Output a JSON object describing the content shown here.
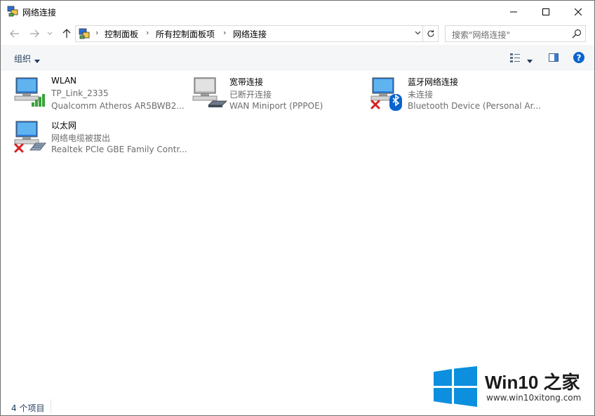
{
  "window": {
    "title": "网络连接",
    "icon": "network-connections-icon",
    "controls": [
      "minimize-icon",
      "maximize-icon",
      "close-icon"
    ]
  },
  "nav": {
    "back": "back-arrow-icon",
    "forward": "forward-arrow-icon",
    "recent": "chevron-down-icon",
    "up": "up-arrow-icon"
  },
  "address": {
    "breadcrumbs": [
      "控制面板",
      "所有控制面板项",
      "网络连接"
    ],
    "separator": "›"
  },
  "search": {
    "placeholder": "搜索\"网络连接\""
  },
  "toolbar": {
    "organize_label": "组织"
  },
  "items": [
    {
      "name": "WLAN",
      "status": "TP_Link_2335",
      "device": "Qualcomm Atheros AR5BWB2...",
      "icon": "wifi-adapter-icon"
    },
    {
      "name": "宽带连接",
      "status": "已断开连接",
      "device": "WAN Miniport (PPPOE)",
      "icon": "broadband-modem-icon"
    },
    {
      "name": "蓝牙网络连接",
      "status": "未连接",
      "device": "Bluetooth Device (Personal Ar...",
      "icon": "bluetooth-adapter-icon"
    },
    {
      "name": "以太网",
      "status": "网络电缆被拔出",
      "device": "Realtek PCIe GBE Family Contr...",
      "icon": "ethernet-adapter-icon"
    }
  ],
  "statusbar": {
    "count": "4 个项目"
  },
  "watermark": {
    "brand": "Win10 之家",
    "url": "www.win10xitong.com"
  },
  "colors": {
    "accent": "#0a64d0",
    "logo": "#0b8fde",
    "error": "#d8201f",
    "signal": "#3aa23a"
  }
}
